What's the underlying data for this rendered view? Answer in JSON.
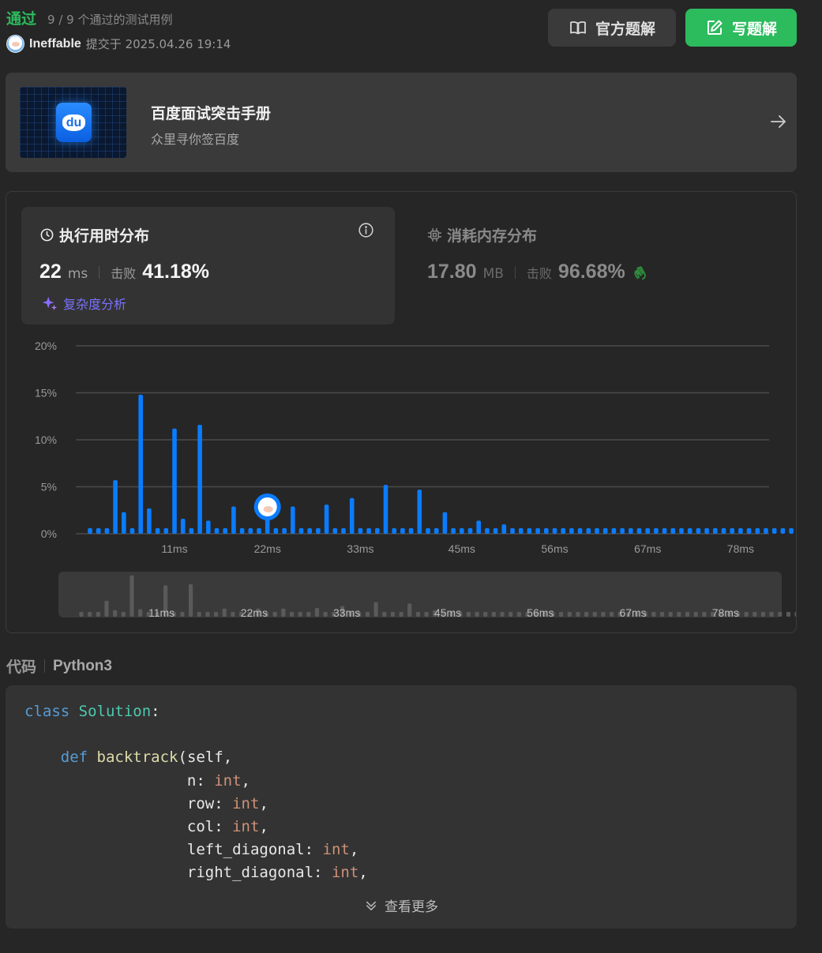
{
  "header": {
    "status": "通过",
    "test_count": "9 / 9 个通过的测试用例",
    "user": "Ineffable",
    "submitted_label": "提交于 2025.04.26 19:14",
    "official_solution_label": "官方题解",
    "write_solution_label": "写题解"
  },
  "promo": {
    "title": "百度面试突击手册",
    "subtitle": "众里寻你签百度",
    "logo_text": "du"
  },
  "runtime": {
    "title": "执行用时分布",
    "value": "22",
    "unit": "ms",
    "beat_label": "击败",
    "beat_value": "41.18%",
    "complexity_label": "复杂度分析"
  },
  "memory": {
    "title": "消耗内存分布",
    "value": "17.80",
    "unit": "MB",
    "beat_label": "击败",
    "beat_value": "96.68%"
  },
  "colors": {
    "accent_green": "#2cbb5d",
    "bar_blue": "#0a7cff",
    "complexity_purple": "#7a72ff",
    "memory_hand": "#2e8b3d"
  },
  "chart_data": {
    "type": "bar",
    "ylabel": "",
    "xlabel": "",
    "ylim": [
      0,
      20
    ],
    "yticks": [
      "20%",
      "15%",
      "10%",
      "5%",
      "0%"
    ],
    "ytick_values": [
      20,
      15,
      10,
      5,
      0
    ],
    "xticks": [
      "11ms",
      "22ms",
      "33ms",
      "45ms",
      "56ms",
      "67ms",
      "78ms"
    ],
    "xtick_values": [
      11,
      22,
      33,
      45,
      56,
      67,
      78
    ],
    "current_value_ms": 22,
    "series": [
      {
        "x": [
          1,
          2,
          3,
          4,
          5,
          6,
          7,
          8,
          9,
          10,
          11,
          12,
          13,
          14,
          15,
          16,
          17,
          18,
          19,
          20,
          21,
          22,
          23,
          24,
          25,
          26,
          27,
          28,
          29,
          30,
          31,
          32,
          33,
          34,
          35,
          36,
          37,
          38,
          39,
          40,
          41,
          42,
          43,
          44,
          45,
          46,
          47,
          48,
          49,
          50,
          51,
          52,
          53,
          54,
          55,
          56,
          57,
          58,
          59,
          60,
          61,
          62,
          63,
          64,
          65,
          66,
          67,
          68,
          69,
          70,
          71,
          72,
          73,
          74,
          75,
          76,
          77,
          78,
          79,
          80,
          81,
          82,
          83,
          84,
          85,
          86,
          87,
          88,
          89
        ],
        "values": [
          0.6,
          0.6,
          0.6,
          5.7,
          2.3,
          0.6,
          14.8,
          2.7,
          0.6,
          0.6,
          11.2,
          1.6,
          0.6,
          11.6,
          1.4,
          0.6,
          0.6,
          2.9,
          0.6,
          0.6,
          0.6,
          2.9,
          0.6,
          0.6,
          2.9,
          0.6,
          0.6,
          0.6,
          3.1,
          0.6,
          0.6,
          3.8,
          0.6,
          0.6,
          0.6,
          5.2,
          0.6,
          0.6,
          0.6,
          4.7,
          0.6,
          0.6,
          2.3,
          0.6,
          0.6,
          0.6,
          1.4,
          0.6,
          0.6,
          1.0,
          0.6,
          0.6,
          0.6,
          0.6,
          0.6,
          0.6,
          0.6,
          0.6,
          0.6,
          0.6,
          0.6,
          0.6,
          0.6,
          0.6,
          0.6,
          0.6,
          0.6,
          0.6,
          0.6,
          0.6,
          0.6,
          0.6,
          0.6,
          0.6,
          0.6,
          0.6,
          0.6,
          0.6,
          0.6,
          0.6,
          0.6,
          0.6,
          0.6,
          0.6,
          0.6,
          0.6,
          0.6,
          0.6,
          0.6
        ]
      }
    ]
  },
  "code": {
    "header_label": "代码",
    "language": "Python3",
    "more_label": "查看更多"
  }
}
